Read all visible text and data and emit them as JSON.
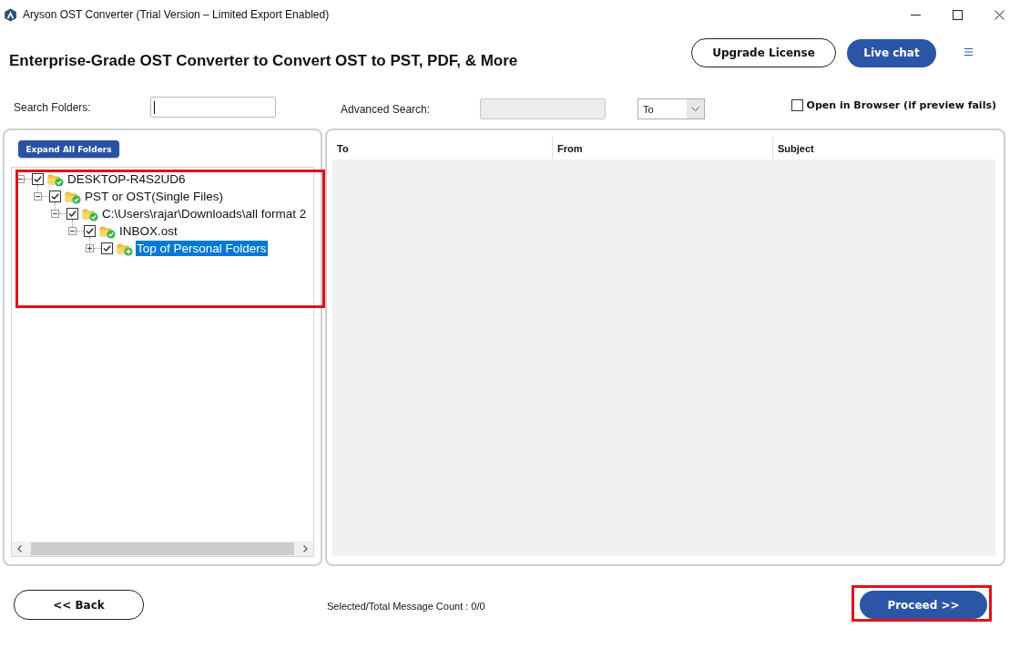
{
  "window": {
    "title": "Aryson OST Converter (Trial Version – Limited Export Enabled)"
  },
  "header": {
    "heading": "Enterprise-Grade OST Converter to Convert OST to PST, PDF, & More",
    "buttons": [
      {
        "label": "Upgrade License",
        "kind": "outline"
      },
      {
        "label": "Live chat",
        "kind": "primary"
      }
    ]
  },
  "search_folders": {
    "label": "Search Folders:",
    "focused": true
  },
  "advanced_search": {
    "label": "Advanced Search:",
    "disabled": true,
    "filter": {
      "value": "To"
    }
  },
  "open_in_browser": {
    "label": "Open in Browser (if preview fails)",
    "checked": false
  },
  "folder_tree": {
    "expand_button": "Expand All Folders",
    "highlighted": true,
    "nodes": [
      {
        "label": "DESKTOP-R4S2UD6",
        "checked": true,
        "expanded": true,
        "selected": false,
        "added": false,
        "children": [
          {
            "label": "PST or OST(Single Files)",
            "checked": true,
            "expanded": true,
            "selected": false,
            "added": false,
            "children": [
              {
                "label": "C:\\Users\\rajar\\Downloads\\all format 2",
                "checked": true,
                "expanded": true,
                "selected": false,
                "added": false,
                "children": [
                  {
                    "label": "INBOX.ost",
                    "checked": true,
                    "expanded": true,
                    "selected": false,
                    "added": false,
                    "children": [
                      {
                        "label": "Top of Personal Folders",
                        "checked": true,
                        "expanded": false,
                        "selected": true,
                        "added": true
                      }
                    ]
                  }
                ]
              }
            ]
          }
        ]
      }
    ]
  },
  "message_list": {
    "columns": [
      "To",
      "From",
      "Subject"
    ]
  },
  "footer": {
    "back_button": "<< Back",
    "message_count": "Selected/Total Message Count : 0/0",
    "proceed_button": {
      "label": "Proceed >>",
      "highlighted": true
    }
  }
}
